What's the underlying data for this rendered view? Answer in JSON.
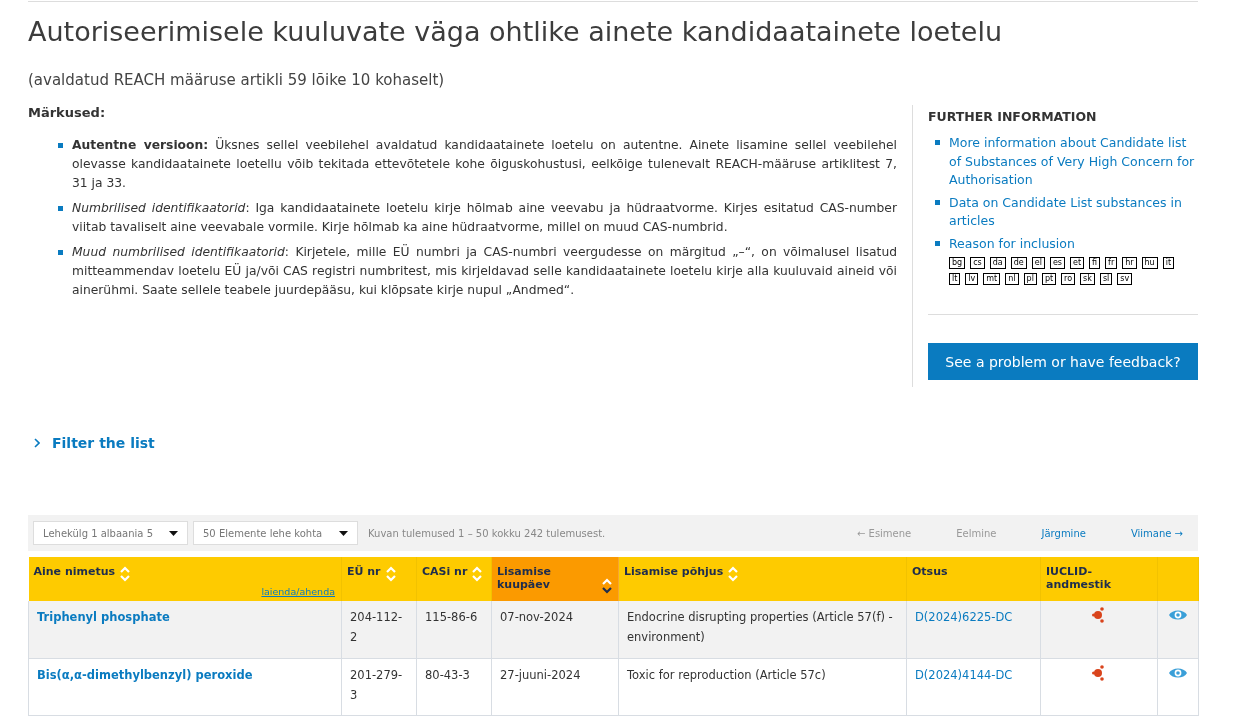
{
  "title": "Autoriseerimisele kuuluvate väga ohtlike ainete kandidaatainete loetelu",
  "subtitle": "(avaldatud REACH määruse artikli 59 lõike 10 kohaselt)",
  "notes": {
    "heading": "Märkused:",
    "items": [
      {
        "text": "**Autentne versioon:** Üksnes sellel veebilehel avaldatud kandidaatainete loetelu on autentne. Ainete lisamine sellel veebilehel olevasse kandidaatainete loetellu võib tekitada ettevõtetele kohe õiguskohustusi, eelkõige tulenevalt REACH-määruse artiklitest 7, 31 ja 33."
      },
      {
        "text": "*Numbrilised identifikaatorid*: Iga kandidaatainete loetelu kirje hõlmab aine veevabu ja hüdraatvorme. Kirjes esitatud CAS-number viitab tavaliselt aine veevabale vormile. Kirje hõlmab ka aine hüdraatvorme, millel on muud CAS-numbrid."
      },
      {
        "text": "*Muud numbrilised identifikaatorid*: Kirjetele, mille EÜ numbri ja CAS-numbri veergudesse on märgitud „–“, on võimalusel lisatud mitteammendav loetelu EÜ ja/või CAS registri numbritest, mis kirjeldavad selle kandidaatainete loetelu kirje alla kuuluvaid aineid või ainerühmi. Saate sellele teabele juurdepääsu, kui klõpsate kirje nupul „Andmed“."
      }
    ]
  },
  "further_information": {
    "heading": "FURTHER INFORMATION",
    "links": [
      "More information about Candidate list of Substances of Very High Concern for Authorisation",
      "Data on Candidate List substances in articles",
      "Reason for inclusion"
    ],
    "languages": [
      [
        "bg",
        "cs",
        "da",
        "de",
        "el",
        "es",
        "et",
        "fi",
        "fr",
        "hr",
        "hu",
        "it"
      ],
      [
        "lt",
        "lv",
        "mt",
        "nl",
        "pl",
        "pt",
        "ro",
        "sk",
        "sl",
        "sv"
      ]
    ]
  },
  "feedback_button": "See a problem or have feedback?",
  "filter": {
    "label": "Filter the list",
    "expanded": false
  },
  "pagination": {
    "page_select": "Lehekülg 1 albaania 5",
    "per_page_select": "50 Elemente lehe kohta",
    "summary": "Kuvan tulemused 1 – 50 kokku 242 tulemusest.",
    "links": [
      {
        "label": "← Esimene",
        "disabled": true
      },
      {
        "label": "Eelmine",
        "disabled": true
      },
      {
        "label": "Järgmine",
        "disabled": false
      },
      {
        "label": "Viimane →",
        "disabled": false
      }
    ]
  },
  "table": {
    "columns": [
      {
        "label": "Aine nimetus",
        "sortable": true,
        "sorted": false,
        "extra": "laienda/ahenda"
      },
      {
        "label": "EÜ nr",
        "sortable": true,
        "sorted": false
      },
      {
        "label": "CASi nr",
        "sortable": true,
        "sorted": false
      },
      {
        "label": "Lisamise kuupäev",
        "sortable": true,
        "sorted": true
      },
      {
        "label": "Lisamise põhjus",
        "sortable": true,
        "sorted": false
      },
      {
        "label": "Otsus",
        "sortable": false,
        "sorted": false
      },
      {
        "label": "IUCLID-andmestik",
        "sortable": false,
        "sorted": false
      },
      {
        "sortable": false,
        "sorted": false
      }
    ],
    "rows": [
      {
        "name": "Triphenyl phosphate",
        "ec": "204-112-2",
        "cas": "115-86-6",
        "date": "07-nov-2024",
        "reason": "Endocrine disrupting properties (Article 57(f) - environment)",
        "decision": "D(2024)6225-DC"
      },
      {
        "name": "Bis(α,α-dimethylbenzyl) peroxide",
        "ec": "201-279-3",
        "cas": "80-43-3",
        "date": "27-juuni-2024",
        "reason": "Toxic for reproduction (Article 57c)",
        "decision": "D(2024)4144-DC"
      }
    ]
  }
}
